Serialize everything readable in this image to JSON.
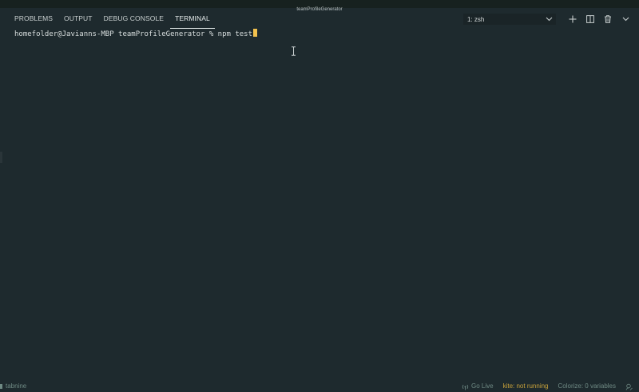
{
  "window": {
    "title": "teamProfileGenerator"
  },
  "panel": {
    "tabs": [
      {
        "label": "PROBLEMS",
        "active": false
      },
      {
        "label": "OUTPUT",
        "active": false
      },
      {
        "label": "DEBUG CONSOLE",
        "active": false
      },
      {
        "label": "TERMINAL",
        "active": true
      }
    ],
    "terminal_select": {
      "selected": "1: zsh",
      "icon": "chevron-down-icon"
    },
    "actions": [
      {
        "name": "new-terminal",
        "icon": "plus-icon"
      },
      {
        "name": "split-terminal",
        "icon": "split-icon"
      },
      {
        "name": "kill-terminal",
        "icon": "trash-icon"
      },
      {
        "name": "maximize-panel",
        "icon": "chevron-down-icon"
      }
    ]
  },
  "terminal": {
    "prompt": "homefolder@Javianns-MBP teamProfileGenerator % ",
    "command": "npm test"
  },
  "statusbar": {
    "left": {
      "tabnine_label": "tabnine"
    },
    "right": {
      "golive_label": "Go Live",
      "kite_label": "kite: not running",
      "colorize_label": "Colorize: 0 variables"
    }
  },
  "colors": {
    "background": "#1e2a2e",
    "cursor": "#f2c14e",
    "kite_warning": "#c8a23a",
    "status_text": "#6f8a84"
  }
}
